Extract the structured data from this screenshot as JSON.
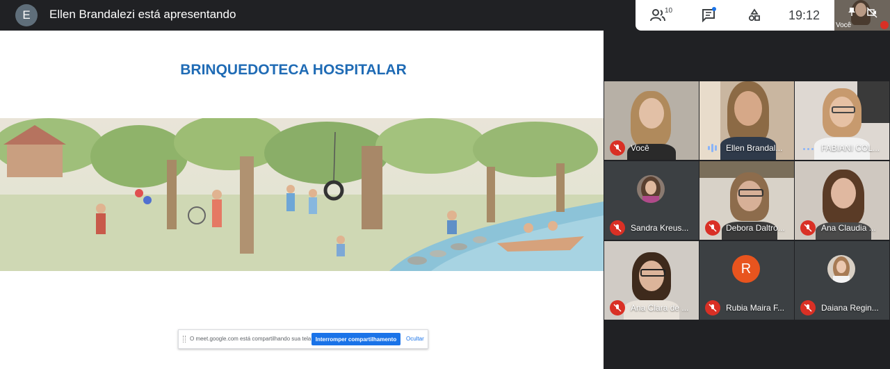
{
  "top_bar": {
    "presenter_initial": "E",
    "presenter_text": "Ellen Brandalezi está apresentando"
  },
  "controls": {
    "people_count": "10",
    "time": "19:12",
    "self_label": "Você"
  },
  "slide": {
    "title": "BRINQUEDOTECA HOSPITALAR"
  },
  "share_notice": {
    "message": "O meet.google.com está compartilhando sua tela.",
    "stop_label": "Interromper compartilhamento",
    "hide_label": "Ocultar"
  },
  "participants": [
    {
      "name": "Você",
      "status": "muted"
    },
    {
      "name": "Ellen Brandal...",
      "status": "speaking"
    },
    {
      "name": "FABIANI COL...",
      "status": "dots"
    },
    {
      "name": "Sandra Kreus...",
      "status": "muted"
    },
    {
      "name": "Debora Daltro...",
      "status": "muted"
    },
    {
      "name": "Ana Claudia ...",
      "status": "muted"
    },
    {
      "name": "Ana Clara de ...",
      "status": "muted"
    },
    {
      "name": "Rubia Maira F...",
      "status": "muted",
      "initial": "R"
    },
    {
      "name": "Daiana Regin...",
      "status": "muted"
    }
  ],
  "colors": {
    "background": "#202124",
    "accent_blue": "#1a73e8",
    "mute_red": "#d93025",
    "title_blue": "#1f6bb5",
    "avatar_orange": "#e8541e"
  }
}
